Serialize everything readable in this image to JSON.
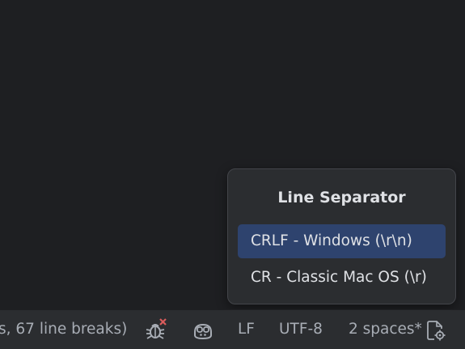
{
  "popup": {
    "title": "Line Separator",
    "items": [
      {
        "label": "CRLF - Windows (\\r\\n)",
        "selected": true
      },
      {
        "label": "CR - Classic Mac OS (\\r)",
        "selected": false
      }
    ]
  },
  "status_bar": {
    "selection_info": "s, 67 line breaks)",
    "inspection_icon": "bug-with-error-icon",
    "ai_assistant_icon": "copilot-icon",
    "line_separator": "LF",
    "encoding": "UTF-8",
    "indent": "2 spaces*",
    "settings_icon": "file-settings-icon"
  },
  "colors": {
    "background": "#1e1f22",
    "popup_bg": "#2b2d30",
    "selection": "#2e436e",
    "error_red": "#db5c5c"
  }
}
